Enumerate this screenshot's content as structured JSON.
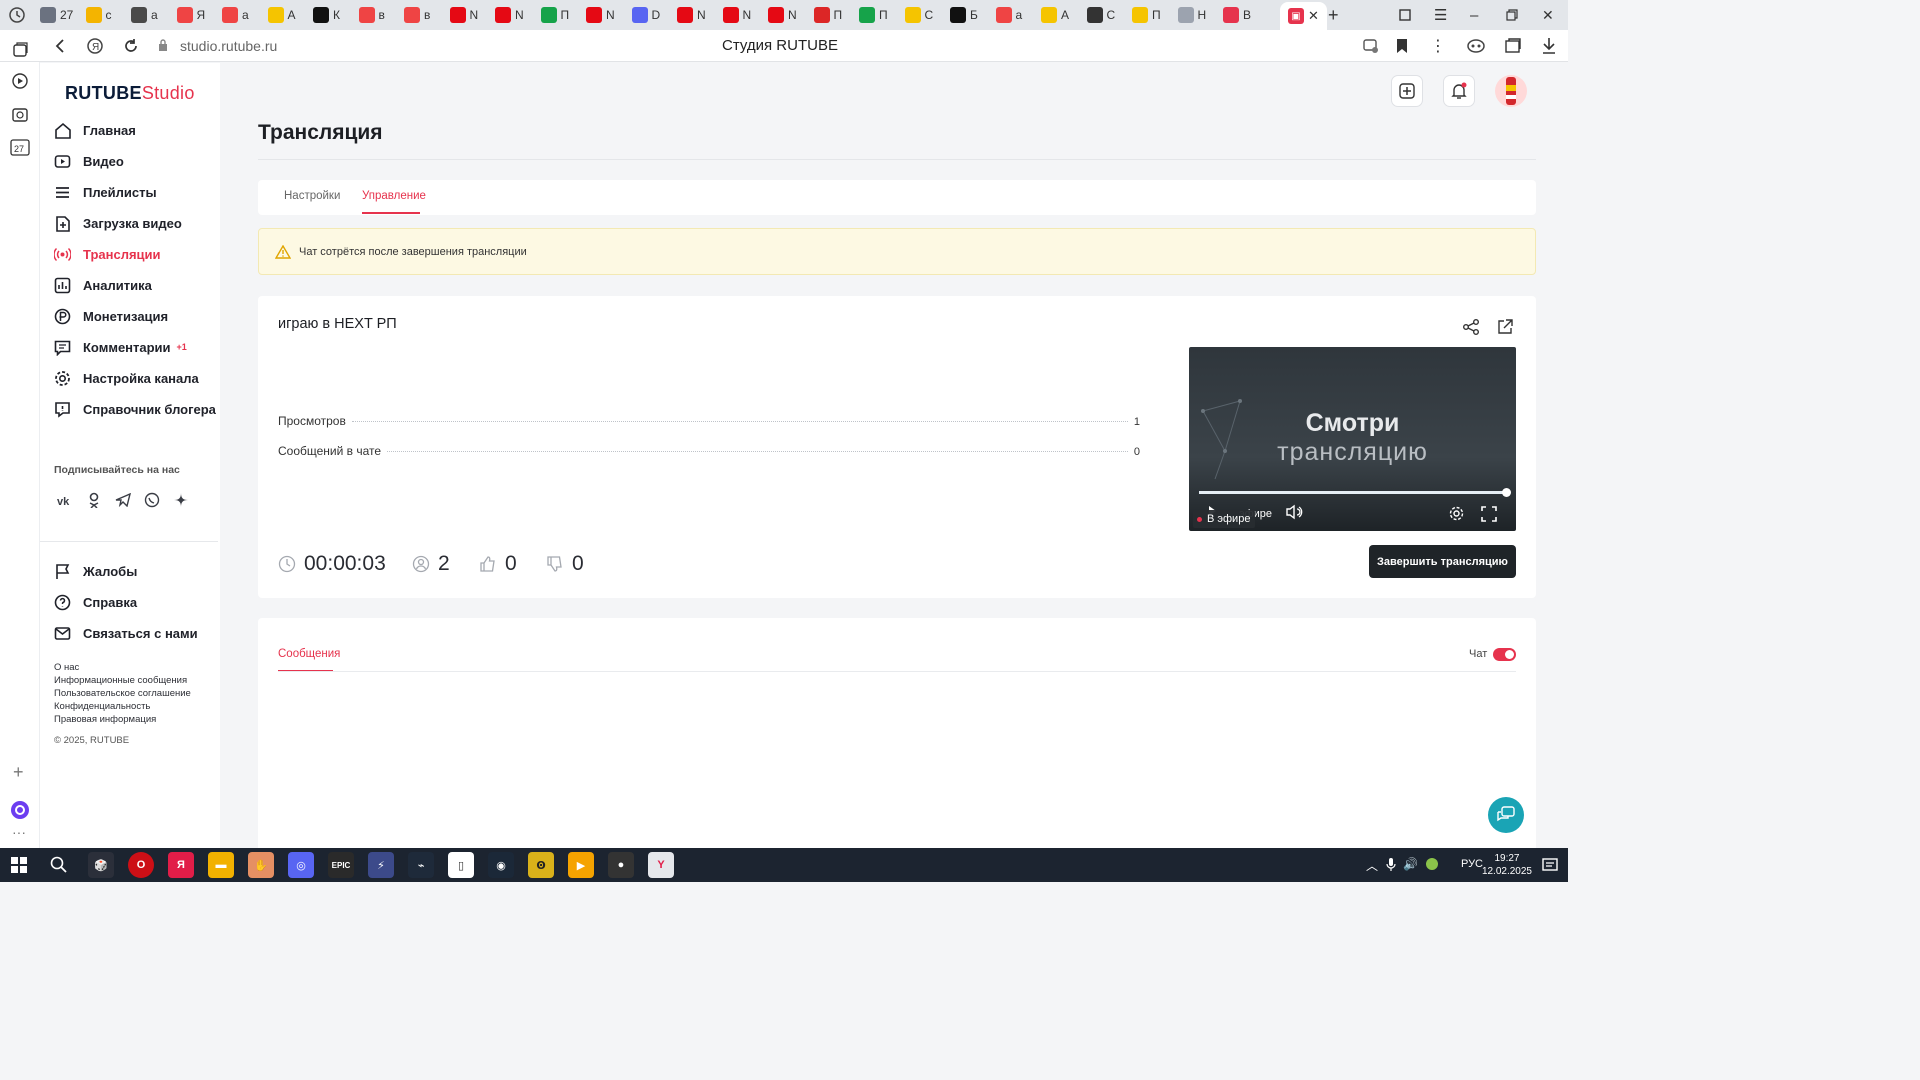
{
  "browser": {
    "tabs": [
      {
        "label": "27",
        "color": "#6b7280"
      },
      {
        "label": "с",
        "color": "#f4b400"
      },
      {
        "label": "а",
        "color": "#4a4a4a"
      },
      {
        "label": "Я",
        "color": "#ef4444"
      },
      {
        "label": "а",
        "color": "#ef4444"
      },
      {
        "label": "А",
        "color": "#f5c400"
      },
      {
        "label": "К",
        "color": "#111111"
      },
      {
        "label": "в",
        "color": "#ef4444"
      },
      {
        "label": "в",
        "color": "#ef4444"
      },
      {
        "label": "N",
        "color": "#e50914"
      },
      {
        "label": "N",
        "color": "#e50914"
      },
      {
        "label": "П",
        "color": "#16a34a"
      },
      {
        "label": "N",
        "color": "#e50914"
      },
      {
        "label": "D",
        "color": "#5865f2"
      },
      {
        "label": "N",
        "color": "#e50914"
      },
      {
        "label": "N",
        "color": "#e50914"
      },
      {
        "label": "N",
        "color": "#e50914"
      },
      {
        "label": "П",
        "color": "#dc2626"
      },
      {
        "label": "П",
        "color": "#16a34a"
      },
      {
        "label": "С",
        "color": "#f5c400"
      },
      {
        "label": "Б",
        "color": "#111111"
      },
      {
        "label": "а",
        "color": "#ef4444"
      },
      {
        "label": "А",
        "color": "#f5c400"
      },
      {
        "label": "С",
        "color": "#333333"
      },
      {
        "label": "П",
        "color": "#f5c400"
      },
      {
        "label": "Н",
        "color": "#9ca3af"
      },
      {
        "label": "В",
        "color": "#e6334d"
      }
    ],
    "active_tab_icon": "rutube-studio-favicon",
    "url": "studio.rutube.ru",
    "page_title": "Студия RUTUBE"
  },
  "sidebar": {
    "logo_main": "RUTUBE",
    "logo_studio": "Studio",
    "nav": [
      {
        "label": "Главная",
        "icon": "home-icon"
      },
      {
        "label": "Видео",
        "icon": "video-icon"
      },
      {
        "label": "Плейлисты",
        "icon": "playlist-icon"
      },
      {
        "label": "Загрузка видео",
        "icon": "upload-icon"
      },
      {
        "label": "Трансляции",
        "icon": "broadcast-icon"
      },
      {
        "label": "Аналитика",
        "icon": "analytics-icon"
      },
      {
        "label": "Монетизация",
        "icon": "monetization-icon"
      },
      {
        "label": "Комментарии",
        "icon": "comments-icon",
        "badge": "+1"
      },
      {
        "label": "Настройка канала",
        "icon": "settings-icon"
      },
      {
        "label": "Справочник блогера",
        "icon": "guide-icon"
      }
    ],
    "subscribe_title": "Подписывайтесь на нас",
    "bottom_nav": [
      {
        "label": "Жалобы",
        "icon": "flag-icon"
      },
      {
        "label": "Справка",
        "icon": "help-icon"
      },
      {
        "label": "Связаться с нами",
        "icon": "mail-icon"
      }
    ],
    "legal_links": [
      "О нас",
      "Информационные сообщения",
      "Пользовательское соглашение",
      "Конфиденциальность",
      "Правовая информация"
    ],
    "copyright": "© 2025, RUTUBE"
  },
  "page": {
    "title": "Трансляция",
    "tabs": [
      "Настройки",
      "Управление"
    ],
    "active_tab": "Управление",
    "warning": "Чат сотрётся после завершения трансляции",
    "stream_title": "играю в HEXT РП",
    "stats": [
      {
        "label": "Просмотров",
        "value": "1"
      },
      {
        "label": "Сообщений в чате",
        "value": "0"
      }
    ],
    "metrics": {
      "duration": "00:00:03",
      "viewers": "2",
      "likes": "0",
      "dislikes": "0"
    },
    "end_button": "Завершить трансляцию",
    "player": {
      "overlay_line1": "Смотри",
      "overlay_line2": "трансляцию",
      "live_label": "В эфире",
      "live_label_2": "эфире",
      "progress_fraction": 1.0
    },
    "chat_tab": "Сообщения",
    "chat_toggle_label": "Чат",
    "chat_enabled": true
  },
  "taskbar": {
    "time": "19:27",
    "date": "12.02.2025",
    "lang": "РУС"
  },
  "colors": {
    "accent": "#e6334d",
    "warning_bg": "#fdf9e3",
    "player_bg": "#2f363c",
    "dark_button": "#1f2428"
  }
}
